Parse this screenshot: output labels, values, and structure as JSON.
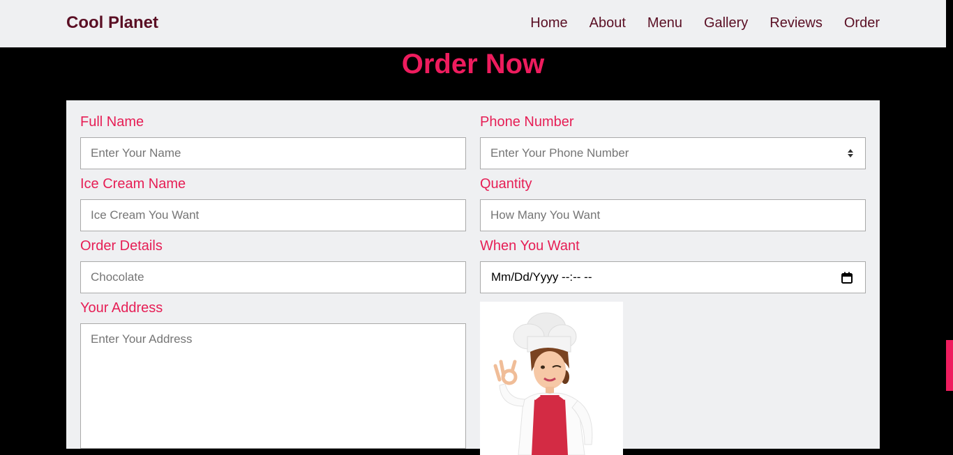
{
  "navbar": {
    "brand": "Cool Planet",
    "links": [
      "Home",
      "About",
      "Menu",
      "Gallery",
      "Reviews",
      "Order"
    ]
  },
  "page": {
    "title": "Order Now"
  },
  "form": {
    "full_name": {
      "label": "Full Name",
      "placeholder": "Enter Your Name"
    },
    "phone": {
      "label": "Phone Number",
      "placeholder": "Enter Your Phone Number"
    },
    "ice_cream": {
      "label": "Ice Cream Name",
      "placeholder": "Ice Cream You Want"
    },
    "quantity": {
      "label": "Quantity",
      "placeholder": "How Many You Want"
    },
    "order_details": {
      "label": "Order Details",
      "placeholder": "Chocolate"
    },
    "when": {
      "label": "When You Want",
      "value": "Mm/Dd/Yyyy --:-- --"
    },
    "address": {
      "label": "Your Address",
      "placeholder": "Enter Your Address"
    }
  },
  "colors": {
    "accent": "#ee1c5e",
    "label": "#e61e55",
    "brand": "#5a0f24",
    "panel": "#eff0f2"
  },
  "icons": [
    "number-spinner-icon",
    "calendar-icon"
  ]
}
